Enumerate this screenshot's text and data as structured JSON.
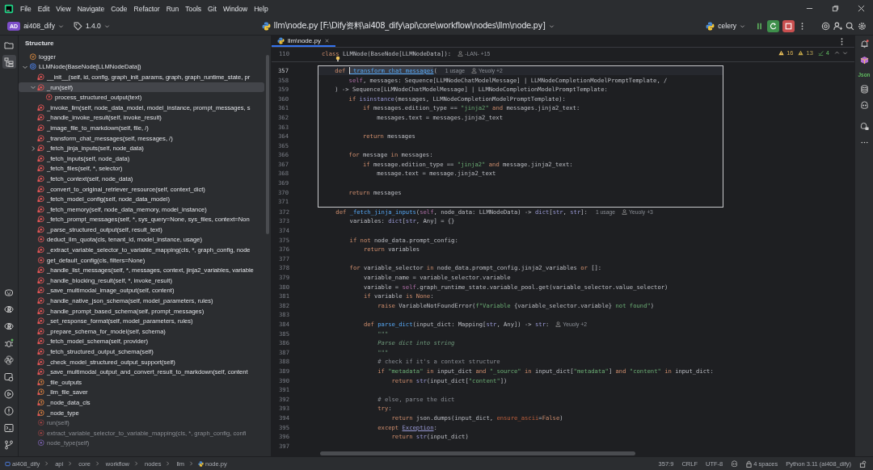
{
  "menu": [
    "File",
    "Edit",
    "View",
    "Navigate",
    "Code",
    "Refactor",
    "Run",
    "Tools",
    "Git",
    "Window",
    "Help"
  ],
  "toolbar": {
    "project_badge": "AD",
    "project": "ai408_dify",
    "branch": "1.4.0",
    "file_title": "llm\\node.py [F:\\Dify资料\\ai408_dify\\api\\core\\workflow\\nodes\\llm\\node.py]",
    "run_config": "celery"
  },
  "left_toolbar": {
    "top": [
      {
        "kind": "project",
        "selected": false
      },
      {
        "kind": "structure",
        "selected": true
      }
    ],
    "bottom": [
      {
        "kind": "bot",
        "selected": false
      },
      {
        "kind": "r-console",
        "selected": false
      },
      {
        "kind": "r-console",
        "selected": false
      },
      {
        "kind": "debug",
        "selected": false
      },
      {
        "kind": "python",
        "selected": false
      },
      {
        "kind": "services",
        "selected": false
      },
      {
        "kind": "run",
        "selected": false
      },
      {
        "kind": "problems",
        "selected": false
      },
      {
        "kind": "terminal",
        "selected": false
      },
      {
        "kind": "git",
        "selected": false
      }
    ]
  },
  "structure_panel": {
    "title": "Structure",
    "items": [
      {
        "text": "logger",
        "kind": "variable",
        "selected": false
      },
      {
        "text": "LLMNode(BaseNode[LLMNodeData])",
        "kind": "class",
        "selected": false,
        "expanded": true,
        "children": [
          {
            "text": "__init__(self, id, config, graph_init_params, graph, graph_runtime_state, pr",
            "kind": "private-method",
            "selected": false
          },
          {
            "text": "_run(self)",
            "kind": "private-method",
            "selected": true,
            "expanded": true,
            "children": [
              {
                "text": "process_structured_output(text)",
                "kind": "function",
                "selected": false
              }
            ]
          },
          {
            "text": "_invoke_llm(self, node_data_model, model_instance, prompt_messages, s",
            "kind": "private-method",
            "selected": false
          },
          {
            "text": "_handle_invoke_result(self, invoke_result)",
            "kind": "private-method",
            "selected": false
          },
          {
            "text": "_image_file_to_markdown(self, file, /)",
            "kind": "private-method",
            "selected": false
          },
          {
            "text": "_transform_chat_messages(self, messages, /)",
            "kind": "private-method",
            "selected": false
          },
          {
            "text": "_fetch_jinja_inputs(self, node_data)",
            "kind": "private-method",
            "selected": false,
            "expanded": false
          },
          {
            "text": "_fetch_inputs(self, node_data)",
            "kind": "private-method",
            "selected": false
          },
          {
            "text": "_fetch_files(self, *, selector)",
            "kind": "private-method",
            "selected": false
          },
          {
            "text": "_fetch_context(self, node_data)",
            "kind": "private-method",
            "selected": false
          },
          {
            "text": "_convert_to_original_retriever_resource(self, context_dict)",
            "kind": "private-method",
            "selected": false
          },
          {
            "text": "_fetch_model_config(self, node_data_model)",
            "kind": "private-method",
            "selected": false
          },
          {
            "text": "_fetch_memory(self, node_data_memory, model_instance)",
            "kind": "private-method",
            "selected": false
          },
          {
            "text": "_fetch_prompt_messages(self, *, sys_query=None, sys_files, context=Non",
            "kind": "private-method",
            "selected": false
          },
          {
            "text": "_parse_structured_output(self, result_text)",
            "kind": "private-method",
            "selected": false
          },
          {
            "text": "deduct_llm_quota(cls, tenant_id, model_instance, usage)",
            "kind": "method",
            "selected": false
          },
          {
            "text": "_extract_variable_selector_to_variable_mapping(cls, *, graph_config, node",
            "kind": "private-method",
            "selected": false
          },
          {
            "text": "get_default_config(cls, filters=None)",
            "kind": "method",
            "selected": false
          },
          {
            "text": "_handle_list_messages(self, *, messages, context, jinja2_variables, variable",
            "kind": "private-method",
            "selected": false
          },
          {
            "text": "_handle_blocking_result(self, *, invoke_result)",
            "kind": "private-method",
            "selected": false
          },
          {
            "text": "_save_multimodal_image_output(self, content)",
            "kind": "private-method",
            "selected": false
          },
          {
            "text": "_handle_native_json_schema(self, model_parameters, rules)",
            "kind": "private-method",
            "selected": false
          },
          {
            "text": "_handle_prompt_based_schema(self, prompt_messages)",
            "kind": "private-method",
            "selected": false
          },
          {
            "text": "_set_response_format(self, model_parameters, rules)",
            "kind": "private-method",
            "selected": false
          },
          {
            "text": "_prepare_schema_for_model(self, schema)",
            "kind": "private-method",
            "selected": false
          },
          {
            "text": "_fetch_model_schema(self, provider)",
            "kind": "private-method",
            "selected": false
          },
          {
            "text": "_fetch_structured_output_schema(self)",
            "kind": "private-method",
            "selected": false
          },
          {
            "text": "_check_model_structured_output_support(self)",
            "kind": "private-method",
            "selected": false
          },
          {
            "text": "_save_multimodal_output_and_convert_result_to_markdown(self, content",
            "kind": "private-method",
            "selected": false
          },
          {
            "text": "_file_outputs",
            "kind": "private-field",
            "selected": false
          },
          {
            "text": "_llm_file_saver",
            "kind": "private-field",
            "selected": false
          },
          {
            "text": "_node_data_cls",
            "kind": "private-field",
            "selected": false
          },
          {
            "text": "_node_type",
            "kind": "private-field",
            "selected": false
          },
          {
            "text": "run(self)",
            "kind": "inherited-method",
            "selected": false
          },
          {
            "text": "extract_variable_selector_to_variable_mapping(cls, *, graph_config, confi",
            "kind": "inherited-method",
            "selected": false
          },
          {
            "text": "node_type(self)",
            "kind": "inherited-property",
            "selected": false
          }
        ]
      }
    ]
  },
  "editor": {
    "tabs": [
      {
        "label": "llm\\node.py",
        "selected": true
      }
    ],
    "inspections": [
      {
        "kind": "warning",
        "count": "16"
      },
      {
        "kind": "weak-warning",
        "count": "13"
      },
      {
        "kind": "ok",
        "count": "4"
      }
    ],
    "sticky_lines": [
      {
        "number": "110",
        "tokens": [
          {
            "kind": "keyword",
            "text": "class "
          },
          {
            "kind": "plain",
            "text": "LLMNode(BaseNode[LLMNodeData]):"
          }
        ],
        "hints": [
          {
            "kind": "author",
            "text": "-LAN- +15"
          }
        ]
      }
    ],
    "lines": [
      {
        "number": "357",
        "current": true,
        "boxed": true,
        "tokens": [
          {
            "kind": "keyword",
            "text": "    def "
          },
          {
            "kind": "caret-identifier",
            "text": "_transform_chat_messages"
          },
          {
            "kind": "plain",
            "text": "("
          }
        ],
        "hints": [
          {
            "kind": "usage",
            "text": "1 usage"
          },
          {
            "kind": "author",
            "text": "Yeuoly +2"
          }
        ]
      },
      {
        "number": "358",
        "current": false,
        "boxed": true,
        "tokens": [
          {
            "kind": "self",
            "text": "        self"
          },
          {
            "kind": "plain",
            "text": ", messages: Sequence[LLMNodeChatModelMessage] | LLMNodeCompletionModelPromptTemplate, /"
          }
        ]
      },
      {
        "number": "359",
        "current": false,
        "boxed": true,
        "tokens": [
          {
            "kind": "plain",
            "text": "    ) -> Sequence[LLMNodeChatModelMessage] | LLMNodeCompletionModelPromptTemplate:"
          }
        ]
      },
      {
        "number": "360",
        "current": false,
        "boxed": true,
        "tokens": [
          {
            "kind": "keyword",
            "text": "        if "
          },
          {
            "kind": "builtin",
            "text": "isinstance"
          },
          {
            "kind": "plain",
            "text": "(messages, LLMNodeCompletionModelPromptTemplate):"
          }
        ]
      },
      {
        "number": "361",
        "current": false,
        "boxed": true,
        "tokens": [
          {
            "kind": "keyword",
            "text": "            if "
          },
          {
            "kind": "plain",
            "text": "messages.edition_type == "
          },
          {
            "kind": "string",
            "text": "\"jinja2\""
          },
          {
            "kind": "keyword",
            "text": " and "
          },
          {
            "kind": "plain",
            "text": "messages.jinja2_text:"
          }
        ]
      },
      {
        "number": "362",
        "current": false,
        "boxed": true,
        "tokens": [
          {
            "kind": "plain",
            "text": "                messages.text = messages.jinja2_text"
          }
        ]
      },
      {
        "number": "363",
        "current": false,
        "boxed": true
      },
      {
        "number": "364",
        "current": false,
        "boxed": true,
        "tokens": [
          {
            "kind": "keyword",
            "text": "            return "
          },
          {
            "kind": "plain",
            "text": "messages"
          }
        ]
      },
      {
        "number": "365",
        "current": false,
        "boxed": true
      },
      {
        "number": "366",
        "current": false,
        "boxed": true,
        "tokens": [
          {
            "kind": "keyword",
            "text": "        for "
          },
          {
            "kind": "plain",
            "text": "message "
          },
          {
            "kind": "keyword",
            "text": "in "
          },
          {
            "kind": "plain",
            "text": "messages:"
          }
        ]
      },
      {
        "number": "367",
        "current": false,
        "boxed": true,
        "tokens": [
          {
            "kind": "keyword",
            "text": "            if "
          },
          {
            "kind": "plain",
            "text": "message.edition_type == "
          },
          {
            "kind": "string",
            "text": "\"jinja2\""
          },
          {
            "kind": "keyword",
            "text": " and "
          },
          {
            "kind": "plain",
            "text": "message.jinja2_text:"
          }
        ]
      },
      {
        "number": "368",
        "current": false,
        "boxed": true,
        "tokens": [
          {
            "kind": "plain",
            "text": "                message.text = message.jinja2_text"
          }
        ]
      },
      {
        "number": "369",
        "current": false,
        "boxed": true
      },
      {
        "number": "370",
        "current": false,
        "boxed": true,
        "tokens": [
          {
            "kind": "keyword",
            "text": "        return "
          },
          {
            "kind": "plain",
            "text": "messages"
          }
        ]
      },
      {
        "number": "371",
        "current": false,
        "boxed": true
      },
      {
        "number": "372",
        "current": false,
        "boxed": false,
        "tokens": [
          {
            "kind": "keyword",
            "text": "    def "
          },
          {
            "kind": "function",
            "text": "_fetch_jinja_inputs"
          },
          {
            "kind": "plain",
            "text": "("
          },
          {
            "kind": "self",
            "text": "self"
          },
          {
            "kind": "plain",
            "text": ", node_data: LLMNodeData) -> "
          },
          {
            "kind": "builtin",
            "text": "dict"
          },
          {
            "kind": "plain",
            "text": "["
          },
          {
            "kind": "builtin",
            "text": "str"
          },
          {
            "kind": "plain",
            "text": ", "
          },
          {
            "kind": "builtin",
            "text": "str"
          },
          {
            "kind": "plain",
            "text": "]:"
          }
        ],
        "hints": [
          {
            "kind": "usage",
            "text": "1 usage"
          },
          {
            "kind": "author",
            "text": "Yeuoly +3"
          }
        ]
      },
      {
        "number": "373",
        "current": false,
        "boxed": false,
        "tokens": [
          {
            "kind": "plain",
            "text": "        variables: "
          },
          {
            "kind": "builtin",
            "text": "dict"
          },
          {
            "kind": "plain",
            "text": "["
          },
          {
            "kind": "builtin",
            "text": "str"
          },
          {
            "kind": "plain",
            "text": ", Any] = {}"
          }
        ]
      },
      {
        "number": "374",
        "current": false,
        "boxed": false
      },
      {
        "number": "375",
        "current": false,
        "boxed": false,
        "tokens": [
          {
            "kind": "keyword",
            "text": "        if not "
          },
          {
            "kind": "plain",
            "text": "node_data.prompt_config:"
          }
        ]
      },
      {
        "number": "376",
        "current": false,
        "boxed": false,
        "tokens": [
          {
            "kind": "keyword",
            "text": "            return "
          },
          {
            "kind": "plain",
            "text": "variables"
          }
        ]
      },
      {
        "number": "377",
        "current": false,
        "boxed": false
      },
      {
        "number": "378",
        "current": false,
        "boxed": false,
        "tokens": [
          {
            "kind": "keyword",
            "text": "        for "
          },
          {
            "kind": "plain",
            "text": "variable_selector "
          },
          {
            "kind": "keyword",
            "text": "in "
          },
          {
            "kind": "plain",
            "text": "node_data.prompt_config.jinja2_variables "
          },
          {
            "kind": "keyword",
            "text": "or "
          },
          {
            "kind": "plain",
            "text": "[]:"
          }
        ]
      },
      {
        "number": "379",
        "current": false,
        "boxed": false,
        "tokens": [
          {
            "kind": "plain",
            "text": "            variable_name = variable_selector.variable"
          }
        ]
      },
      {
        "number": "380",
        "current": false,
        "boxed": false,
        "tokens": [
          {
            "kind": "plain",
            "text": "            variable = "
          },
          {
            "kind": "self",
            "text": "self"
          },
          {
            "kind": "plain",
            "text": ".graph_runtime_state.variable_pool.get(variable_selector.value_selector)"
          }
        ]
      },
      {
        "number": "381",
        "current": false,
        "boxed": false,
        "tokens": [
          {
            "kind": "keyword",
            "text": "            if "
          },
          {
            "kind": "plain",
            "text": "variable "
          },
          {
            "kind": "keyword",
            "text": "is None"
          },
          {
            "kind": "plain",
            "text": ":"
          }
        ]
      },
      {
        "number": "382",
        "current": false,
        "boxed": false,
        "tokens": [
          {
            "kind": "keyword",
            "text": "                raise "
          },
          {
            "kind": "plain",
            "text": "VariableNotFoundError("
          },
          {
            "kind": "string",
            "text": "f\"Variable "
          },
          {
            "kind": "plain",
            "text": "{variable_selector.variable}"
          },
          {
            "kind": "string",
            "text": " not found\""
          },
          {
            "kind": "plain",
            "text": ")"
          }
        ]
      },
      {
        "number": "383",
        "current": false,
        "boxed": false
      },
      {
        "number": "384",
        "current": false,
        "boxed": false,
        "tokens": [
          {
            "kind": "keyword",
            "text": "            def "
          },
          {
            "kind": "function",
            "text": "parse_dict"
          },
          {
            "kind": "plain",
            "text": "(input_dict: Mapping["
          },
          {
            "kind": "builtin",
            "text": "str"
          },
          {
            "kind": "plain",
            "text": ", Any]) -> "
          },
          {
            "kind": "builtin",
            "text": "str"
          },
          {
            "kind": "plain",
            "text": ":"
          }
        ],
        "hints": [
          {
            "kind": "author",
            "text": "Yeuoly +2"
          }
        ]
      },
      {
        "number": "385",
        "current": false,
        "boxed": false,
        "tokens": [
          {
            "kind": "docstring",
            "text": "                \"\"\""
          }
        ]
      },
      {
        "number": "386",
        "current": false,
        "boxed": false,
        "tokens": [
          {
            "kind": "docstring",
            "text": "                Parse dict into string"
          }
        ]
      },
      {
        "number": "387",
        "current": false,
        "boxed": false,
        "tokens": [
          {
            "kind": "docstring",
            "text": "                \"\"\""
          }
        ]
      },
      {
        "number": "388",
        "current": false,
        "boxed": false,
        "tokens": [
          {
            "kind": "comment",
            "text": "                # check if it's a context structure"
          }
        ]
      },
      {
        "number": "389",
        "current": false,
        "boxed": false,
        "tokens": [
          {
            "kind": "keyword",
            "text": "                if "
          },
          {
            "kind": "string",
            "text": "\"metadata\""
          },
          {
            "kind": "keyword",
            "text": " in "
          },
          {
            "kind": "plain",
            "text": "input_dict "
          },
          {
            "kind": "keyword",
            "text": "and "
          },
          {
            "kind": "string",
            "text": "\"_source\""
          },
          {
            "kind": "keyword",
            "text": " in "
          },
          {
            "kind": "plain",
            "text": "input_dict["
          },
          {
            "kind": "string",
            "text": "\"metadata\""
          },
          {
            "kind": "plain",
            "text": "] "
          },
          {
            "kind": "keyword",
            "text": "and "
          },
          {
            "kind": "string",
            "text": "\"content\""
          },
          {
            "kind": "keyword",
            "text": " in "
          },
          {
            "kind": "plain",
            "text": "input_dict:"
          }
        ]
      },
      {
        "number": "390",
        "current": false,
        "boxed": false,
        "tokens": [
          {
            "kind": "keyword",
            "text": "                    return "
          },
          {
            "kind": "builtin",
            "text": "str"
          },
          {
            "kind": "plain",
            "text": "(input_dict["
          },
          {
            "kind": "string",
            "text": "\"content\""
          },
          {
            "kind": "plain",
            "text": "])"
          }
        ]
      },
      {
        "number": "391",
        "current": false,
        "boxed": false
      },
      {
        "number": "392",
        "current": false,
        "boxed": false,
        "tokens": [
          {
            "kind": "comment",
            "text": "                # else, parse the dict"
          }
        ]
      },
      {
        "number": "393",
        "current": false,
        "boxed": false,
        "tokens": [
          {
            "kind": "keyword",
            "text": "                try"
          },
          {
            "kind": "plain",
            "text": ":"
          }
        ]
      },
      {
        "number": "394",
        "current": false,
        "boxed": false,
        "tokens": [
          {
            "kind": "keyword",
            "text": "                    return "
          },
          {
            "kind": "plain",
            "text": "json.dumps(input_dict, "
          },
          {
            "kind": "parameter",
            "text": "ensure_ascii"
          },
          {
            "kind": "plain",
            "text": "="
          },
          {
            "kind": "keyword",
            "text": "False"
          },
          {
            "kind": "plain",
            "text": ")"
          }
        ]
      },
      {
        "number": "395",
        "current": false,
        "boxed": false,
        "tokens": [
          {
            "kind": "keyword",
            "text": "                except "
          },
          {
            "kind": "class-reference",
            "text": "Exception"
          },
          {
            "kind": "plain",
            "text": ":"
          }
        ]
      },
      {
        "number": "396",
        "current": false,
        "boxed": false,
        "tokens": [
          {
            "kind": "keyword",
            "text": "                    return "
          },
          {
            "kind": "builtin",
            "text": "str"
          },
          {
            "kind": "plain",
            "text": "(input_dict)"
          }
        ]
      },
      {
        "number": "397",
        "current": false,
        "boxed": false
      }
    ]
  },
  "right_toolbar": [
    {
      "kind": "notifications"
    },
    {
      "kind": "plugin"
    },
    {
      "kind": "label",
      "label": "Json"
    },
    {
      "kind": "database"
    },
    {
      "kind": "assistant"
    },
    {
      "kind": "assistant-chat"
    },
    {
      "kind": "more"
    }
  ],
  "status_bar": {
    "breadcrumbs": [
      "ai408_dify",
      "api",
      "core",
      "workflow",
      "nodes",
      "llm",
      "node.py"
    ],
    "position": "357:9",
    "line_separator": "CRLF",
    "encoding": "UTF-8",
    "indent": "4 spaces",
    "interpreter": "Python 3.11 (ai408_dify)"
  }
}
